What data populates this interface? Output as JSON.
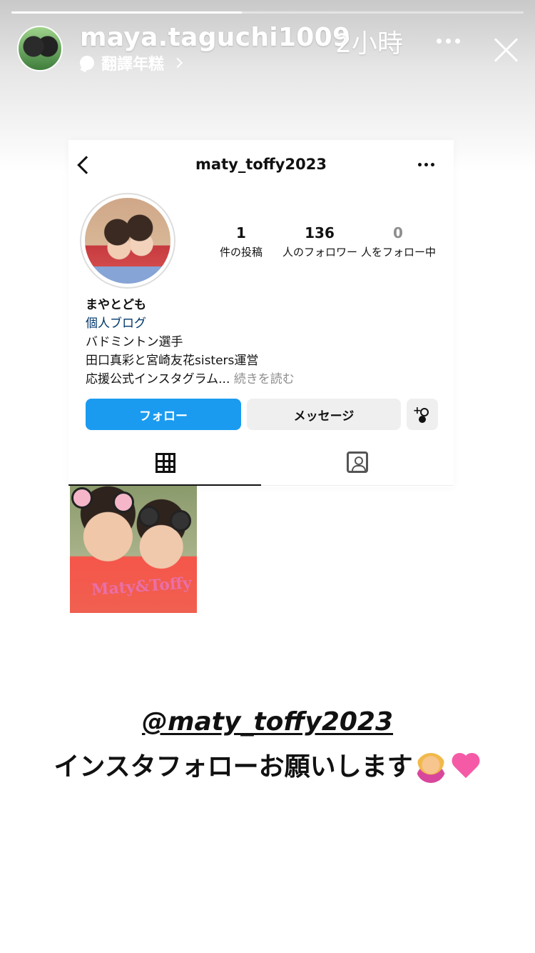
{
  "story": {
    "progress_fraction": 0.45,
    "username": "maya.taguchi1009",
    "time": "2小時",
    "translate_label": "翻譯年糕"
  },
  "profile": {
    "handle": "maty_toffy2023",
    "stats": [
      {
        "value": "1",
        "label": "件の投稿"
      },
      {
        "value": "136",
        "label": "人のフォロワー"
      },
      {
        "value": "0",
        "label": "人をフォロー中"
      }
    ],
    "bio": {
      "name": "まやとども",
      "link": "個人ブログ",
      "line1": "バドミントン選手",
      "line2": "田口真彩と宮崎友花sisters運営",
      "line3": "応援公式インスタグラム...",
      "more": "続きを読む"
    },
    "buttons": {
      "follow": "フォロー",
      "message": "メッセージ"
    },
    "post_caption": "Maty&Toffy"
  },
  "caption": {
    "mention": "@maty_toffy2023",
    "text": "インスタフォローお願いします"
  },
  "colors": {
    "follow_button": "#1a9bf0",
    "link": "#00376b",
    "heart": "#f55aa6"
  }
}
